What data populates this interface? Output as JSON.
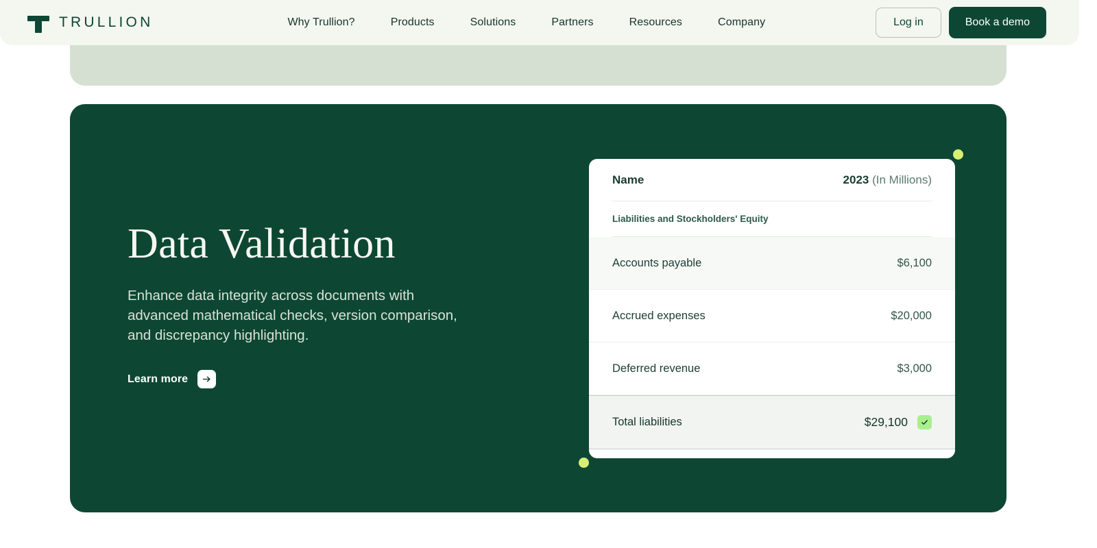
{
  "navbar": {
    "brand": {
      "wordmark": "TRULLION",
      "logo_icon": "trullion-t-mark"
    },
    "links": [
      {
        "label": "Why Trullion?"
      },
      {
        "label": "Products"
      },
      {
        "label": "Solutions"
      },
      {
        "label": "Partners"
      },
      {
        "label": "Resources"
      },
      {
        "label": "Company"
      }
    ],
    "login_label": "Log in",
    "demo_label": "Book a demo"
  },
  "hero": {
    "title": "Data Validation",
    "description": "Enhance data integrity across documents with advanced mathematical checks, version comparison, and discrepancy highlighting.",
    "learn_more_label": "Learn more",
    "learn_more_icon": "arrow-right-icon"
  },
  "table_card": {
    "header": {
      "name_label": "Name",
      "year": "2023",
      "units": " (In Millions)"
    },
    "section_label": "Liabilities and Stockholders' Equity",
    "rows": [
      {
        "label": "Accounts payable",
        "value": "$6,100",
        "highlight": true
      },
      {
        "label": "Accrued expenses",
        "value": "$20,000",
        "highlight": false
      },
      {
        "label": "Deferred revenue",
        "value": "$3,000",
        "highlight": false
      }
    ],
    "total": {
      "label": "Total liabilities",
      "value": "$29,100",
      "status_icon": "check-icon"
    }
  },
  "colors": {
    "brand_green": "#0D4734",
    "navbar_bg": "#F4F6F0",
    "sage_panel": "#D5DFD2",
    "accent_lime": "#D7EF72",
    "check_badge": "#A8EF8E"
  }
}
